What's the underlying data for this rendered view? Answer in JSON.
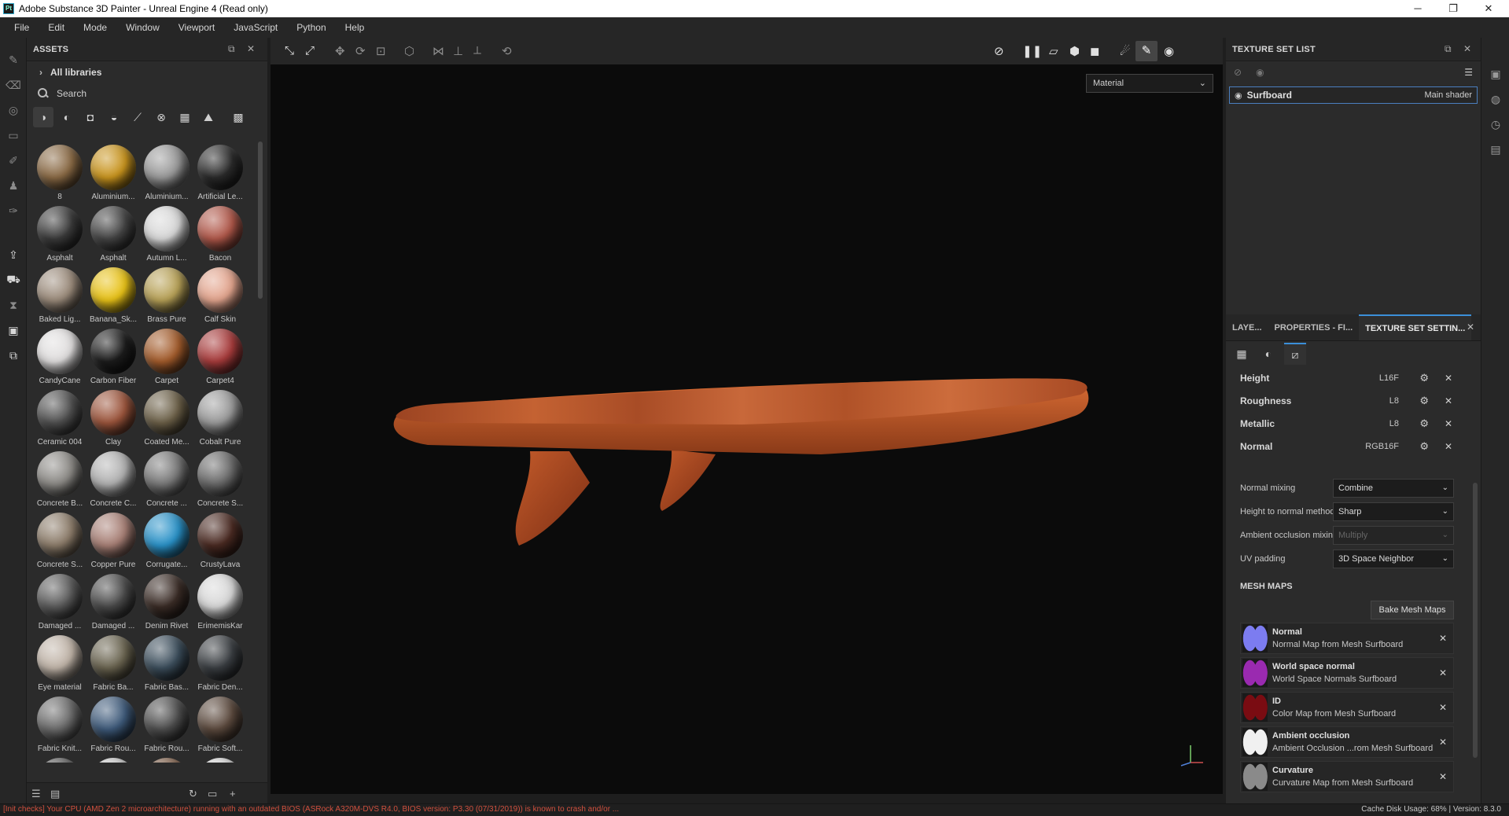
{
  "window": {
    "app_icon_text": "Pt",
    "title": "Adobe Substance 3D Painter - Unreal Engine 4 (Read only)",
    "minimize": "─",
    "maximize": "❐",
    "close": "✕"
  },
  "menu": [
    "File",
    "Edit",
    "Mode",
    "Window",
    "Viewport",
    "JavaScript",
    "Python",
    "Help"
  ],
  "assets_panel": {
    "title": "ASSETS",
    "libraries_label": "All libraries",
    "search_placeholder": "Search",
    "items": [
      {
        "name": "8",
        "color": "#8a6a45"
      },
      {
        "name": "Aluminium...",
        "color": "#c8941e"
      },
      {
        "name": "Aluminium...",
        "color": "#9a9a9a"
      },
      {
        "name": "Artificial Le...",
        "color": "#2a2a2a"
      },
      {
        "name": "Asphalt",
        "color": "#3a3a3a"
      },
      {
        "name": "Asphalt",
        "color": "#444444"
      },
      {
        "name": "Autumn L...",
        "color": "#d8d8d8"
      },
      {
        "name": "Bacon",
        "color": "#b0584a"
      },
      {
        "name": "Baked Lig...",
        "color": "#9c8c7c"
      },
      {
        "name": "Banana_Sk...",
        "color": "#e8c218"
      },
      {
        "name": "Brass Pure",
        "color": "#b8a258"
      },
      {
        "name": "Calf Skin",
        "color": "#e3a58e"
      },
      {
        "name": "CandyCane",
        "color": "#e0dede"
      },
      {
        "name": "Carbon Fiber",
        "color": "#1c1c1c"
      },
      {
        "name": "Carpet",
        "color": "#a35c2c"
      },
      {
        "name": "Carpet4",
        "color": "#a83c3c"
      },
      {
        "name": "Ceramic 004",
        "color": "#505050"
      },
      {
        "name": "Clay",
        "color": "#9c553c"
      },
      {
        "name": "Coated Me...",
        "color": "#6c6048"
      },
      {
        "name": "Cobalt Pure",
        "color": "#9c9c9c"
      },
      {
        "name": "Concrete B...",
        "color": "#8c8a86"
      },
      {
        "name": "Concrete C...",
        "color": "#b2b2b2"
      },
      {
        "name": "Concrete ...",
        "color": "#7a7a7a"
      },
      {
        "name": "Concrete S...",
        "color": "#6a6a6a"
      },
      {
        "name": "Concrete S...",
        "color": "#8c7c6a"
      },
      {
        "name": "Copper Pure",
        "color": "#a88076"
      },
      {
        "name": "Corrugate...",
        "color": "#2a92c8"
      },
      {
        "name": "CrustyLava",
        "color": "#4a2a22"
      },
      {
        "name": "Damaged ...",
        "color": "#5c5c5c"
      },
      {
        "name": "Damaged ...",
        "color": "#4a4a4a"
      },
      {
        "name": "Denim Rivet",
        "color": "#3a2c26"
      },
      {
        "name": "ErimemisKar",
        "color": "#d8d8d8"
      },
      {
        "name": "Eye material",
        "color": "#c0b4a8"
      },
      {
        "name": "Fabric Ba...",
        "color": "#6a6450"
      },
      {
        "name": "Fabric Bas...",
        "color": "#3c4e5c"
      },
      {
        "name": "Fabric Den...",
        "color": "#3a3e42"
      },
      {
        "name": "Fabric Knit...",
        "color": "#6c6c6c"
      },
      {
        "name": "Fabric Rou...",
        "color": "#3e5a7a"
      },
      {
        "name": "Fabric Rou...",
        "color": "#4e4e4e"
      },
      {
        "name": "Fabric Soft...",
        "color": "#5c4a3e"
      },
      {
        "name": "",
        "color": "#5a5a5a"
      },
      {
        "name": "",
        "color": "#c8c8c8"
      },
      {
        "name": "",
        "color": "#7a5a44"
      },
      {
        "name": "",
        "color": "#d4d4d4"
      }
    ]
  },
  "viewport": {
    "display_mode": "Material",
    "board_color": "#b0562c"
  },
  "texture_set_list": {
    "title": "TEXTURE SET LIST",
    "entry_name": "Surfboard",
    "entry_shader": "Main shader"
  },
  "tabs": {
    "layers": "LAYE...",
    "properties": "PROPERTIES - FI...",
    "texture_set_settings": "TEXTURE SET SETTIN..."
  },
  "channels": [
    {
      "name": "Height",
      "format": "L16F"
    },
    {
      "name": "Roughness",
      "format": "L8"
    },
    {
      "name": "Metallic",
      "format": "L8"
    },
    {
      "name": "Normal",
      "format": "RGB16F"
    }
  ],
  "settings": {
    "normal_mixing_label": "Normal mixing",
    "normal_mixing_value": "Combine",
    "height_to_normal_label": "Height to normal method",
    "height_to_normal_value": "Sharp",
    "ao_mixing_label": "Ambient occlusion mixing",
    "ao_mixing_value": "Multiply",
    "uv_padding_label": "UV padding",
    "uv_padding_value": "3D Space Neighbor"
  },
  "mesh_maps": {
    "title": "MESH MAPS",
    "bake_button": "Bake Mesh Maps",
    "items": [
      {
        "name": "Normal",
        "desc": "Normal Map from Mesh Surfboard",
        "color": "#7c7cf0"
      },
      {
        "name": "World space normal",
        "desc": "World Space Normals Surfboard",
        "color": "#9a2ab0"
      },
      {
        "name": "ID",
        "desc": "Color Map from Mesh Surfboard",
        "color": "#7a0c12"
      },
      {
        "name": "Ambient occlusion",
        "desc": "Ambient Occlusion ...rom Mesh Surfboard",
        "color": "#f0f0f0"
      },
      {
        "name": "Curvature",
        "desc": "Curvature Map from Mesh Surfboard",
        "color": "#8a8a8a"
      }
    ]
  },
  "status": {
    "error": "[Init checks] Your CPU (AMD Zen 2 microarchitecture) running with an outdated BIOS (ASRock A320M-DVS R4.0, BIOS version: P3.30 (07/31/2019)) is known to crash and/or ...",
    "cache": "Cache Disk Usage:   68% | Version: 8.3.0"
  }
}
